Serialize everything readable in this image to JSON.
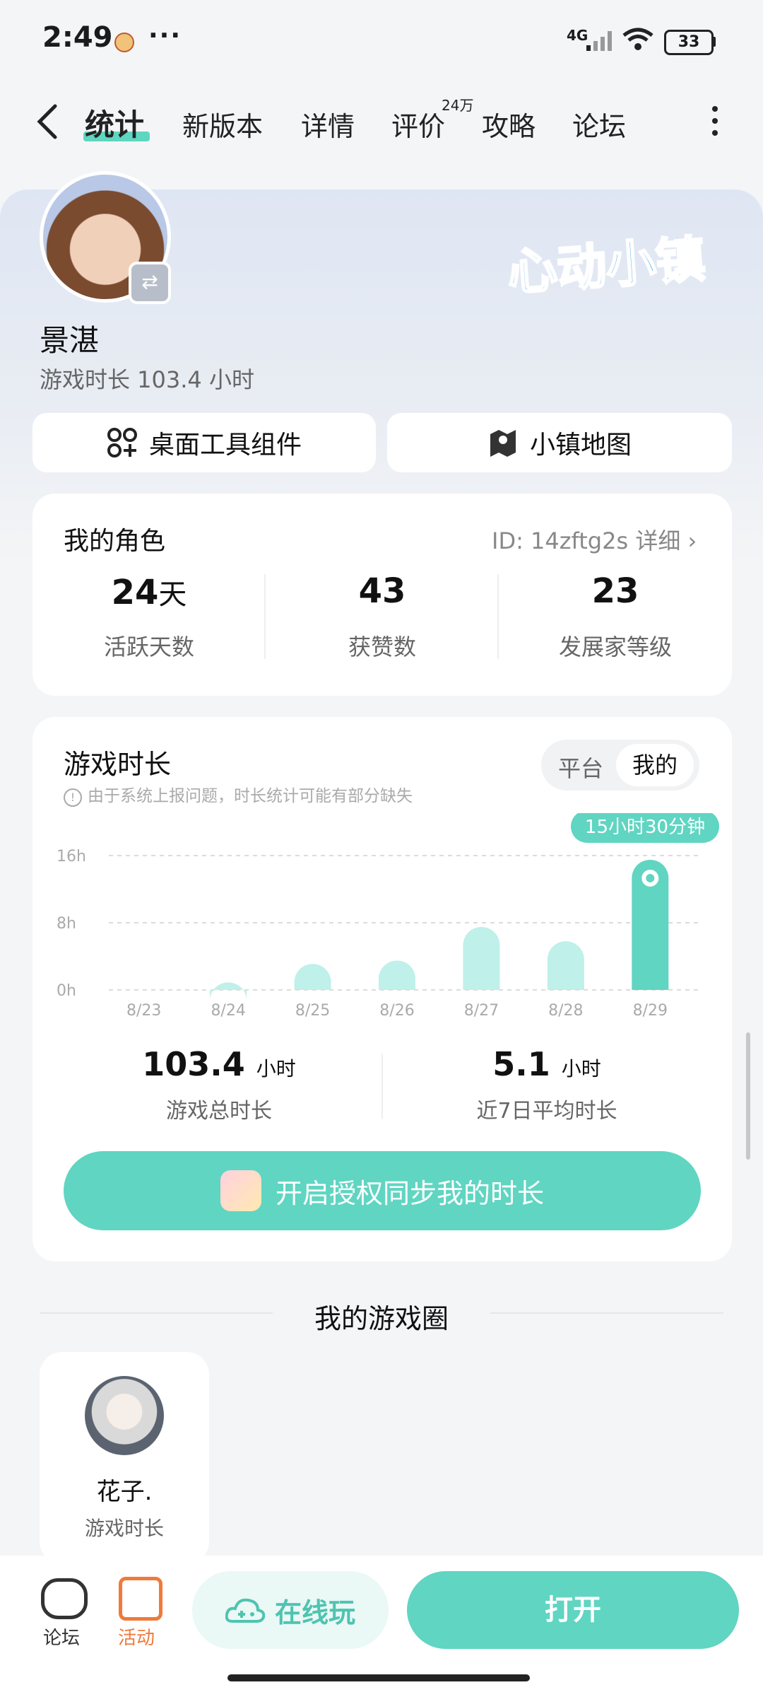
{
  "status": {
    "time": "2:49",
    "more": "···",
    "network": "4G",
    "battery": "33"
  },
  "nav": {
    "back": "‹",
    "tabs": [
      "统计",
      "新版本",
      "详情",
      "评价",
      "攻略",
      "论坛"
    ],
    "review_badge": "24万",
    "more": "⋮"
  },
  "header": {
    "game_logo": "心动小镇",
    "player_name": "景湛",
    "play_time": "游戏时长 103.4 小时",
    "buttons": [
      {
        "label": "桌面工具组件",
        "icon": "widget-icon"
      },
      {
        "label": "小镇地图",
        "icon": "map-icon"
      }
    ]
  },
  "role": {
    "title": "我的角色",
    "id_text": "ID: 14zftg2s 详细 ›",
    "stats": [
      {
        "value": "24",
        "unit": "天",
        "label": "活跃天数"
      },
      {
        "value": "43",
        "unit": "",
        "label": "获赞数"
      },
      {
        "value": "23",
        "unit": "",
        "label": "发展家等级"
      }
    ]
  },
  "playtime": {
    "title": "游戏时长",
    "note": "由于系统上报问题，时长统计可能有部分缺失",
    "toggle": {
      "platform": "平台",
      "mine": "我的"
    },
    "total_value": "103.4",
    "total_unit": "小时",
    "total_label": "游戏总时长",
    "avg_value": "5.1",
    "avg_unit": "小时",
    "avg_label": "近7日平均时长",
    "sync_button": "开启授权同步我的时长"
  },
  "chart_data": {
    "type": "bar",
    "categories": [
      "8/23",
      "8/24",
      "8/25",
      "8/26",
      "8/27",
      "8/28",
      "8/29"
    ],
    "values": [
      0,
      0.9,
      3.1,
      3.5,
      7.5,
      5.8,
      15.5
    ],
    "yticks": [
      "0h",
      "8h",
      "16h"
    ],
    "ylim": [
      0,
      16
    ],
    "highlight_index": 6,
    "highlight_label": "15小时30分钟",
    "bar_color": "#bff0ea",
    "highlight_color": "#60d5c2",
    "grid": true
  },
  "circle": {
    "title": "我的游戏圈",
    "friends": [
      {
        "name": "花子.",
        "label": "游戏时长"
      }
    ]
  },
  "bottom": {
    "forum": "论坛",
    "activity": "活动",
    "online": "在线玩",
    "open": "打开"
  }
}
